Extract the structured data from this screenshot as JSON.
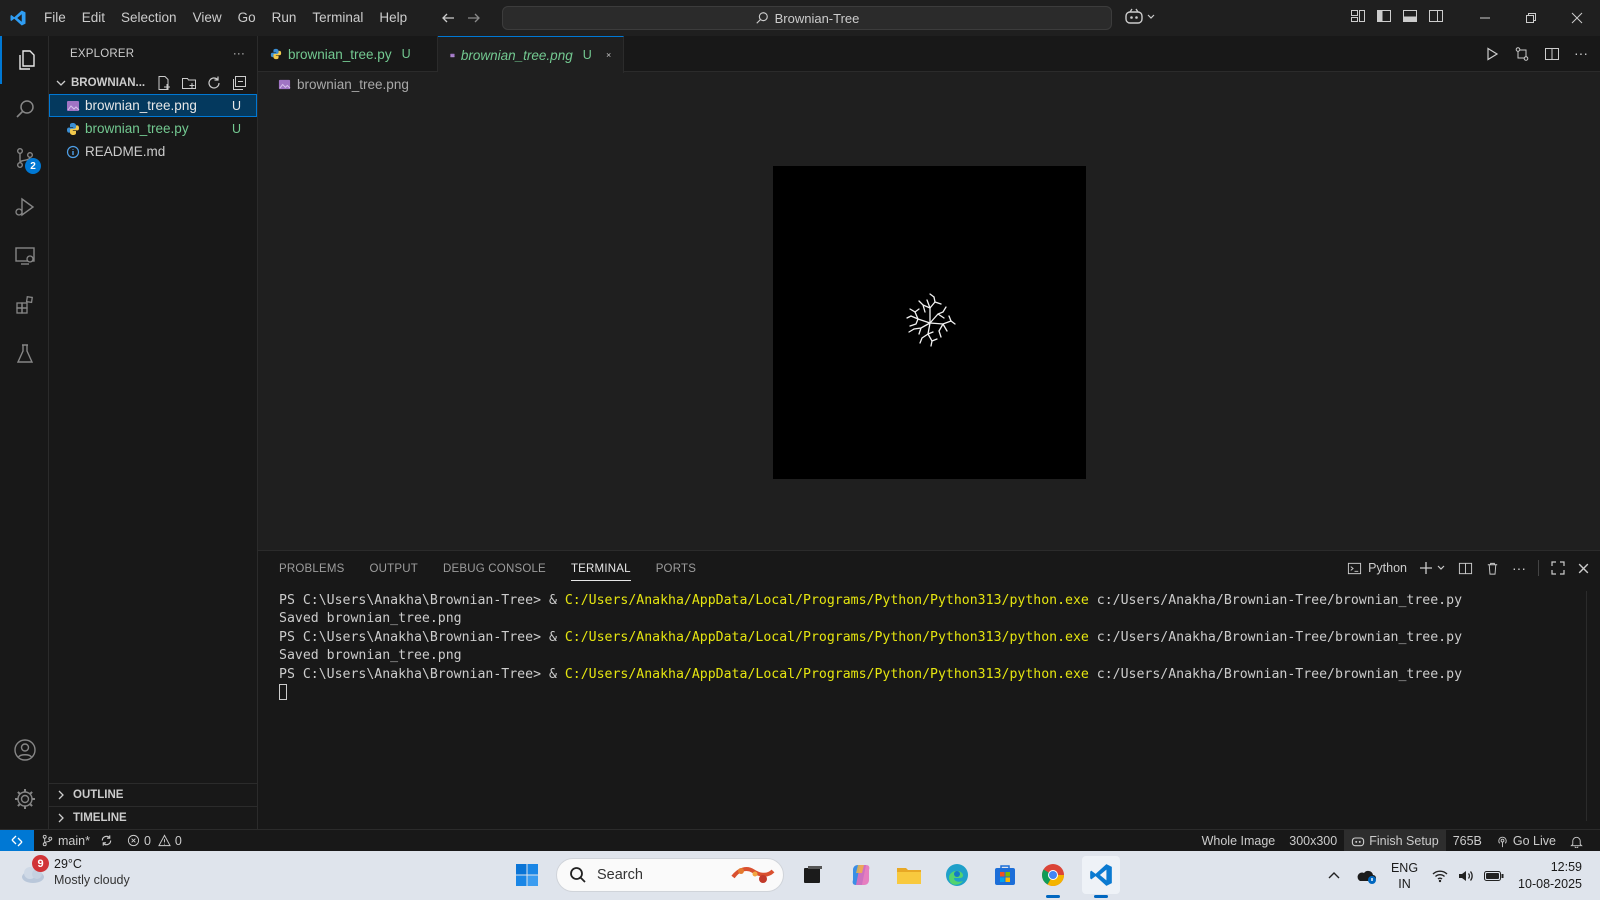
{
  "titlebar": {
    "menu": [
      "File",
      "Edit",
      "Selection",
      "View",
      "Go",
      "Run",
      "Terminal",
      "Help"
    ],
    "command_center": "Brownian-Tree"
  },
  "activitybar": {
    "items": [
      "explorer",
      "search",
      "source-control",
      "run-and-debug",
      "remote-explorer",
      "extensions",
      "testing"
    ],
    "source_control_badge": "2"
  },
  "sidebar": {
    "title": "EXPLORER",
    "folder": "BROWNIAN...",
    "files": [
      {
        "name": "brownian_tree.png",
        "status": "U",
        "icon": "image-icon"
      },
      {
        "name": "brownian_tree.py",
        "status": "U",
        "icon": "python-icon"
      },
      {
        "name": "README.md",
        "status": "",
        "icon": "info-icon"
      }
    ],
    "outline": "OUTLINE",
    "timeline": "TIMELINE"
  },
  "editor": {
    "tabs": [
      {
        "label": "brownian_tree.py",
        "status": "U"
      },
      {
        "label": "brownian_tree.png",
        "status": "U"
      }
    ],
    "breadcrumb": "brownian_tree.png"
  },
  "panel": {
    "tabs": [
      "PROBLEMS",
      "OUTPUT",
      "DEBUG CONSOLE",
      "TERMINAL",
      "PORTS"
    ],
    "active_tab": "TERMINAL",
    "shell": "Python",
    "terminal_lines": [
      {
        "prompt": "PS C:\\Users\\Anakha\\Brownian-Tree> & ",
        "exe": "C:/Users/Anakha/AppData/Local/Programs/Python/Python313/python.exe",
        "arg": " c:/Users/Anakha/Brownian-Tree/brownian_tree.py"
      },
      {
        "output": "Saved brownian_tree.png"
      },
      {
        "prompt": "PS C:\\Users\\Anakha\\Brownian-Tree> & ",
        "exe": "C:/Users/Anakha/AppData/Local/Programs/Python/Python313/python.exe",
        "arg": " c:/Users/Anakha/Brownian-Tree/brownian_tree.py"
      },
      {
        "output": "Saved brownian_tree.png"
      },
      {
        "prompt": "PS C:\\Users\\Anakha\\Brownian-Tree> & ",
        "exe": "C:/Users/Anakha/AppData/Local/Programs/Python/Python313/python.exe",
        "arg": " c:/Users/Anakha/Brownian-Tree/brownian_tree.py"
      }
    ]
  },
  "statusbar": {
    "branch": "main*",
    "errors": "0",
    "warnings": "0",
    "image_mode": "Whole Image",
    "dimensions": "300x300",
    "finish_setup": "Finish Setup",
    "size": "765B",
    "go_live": "Go Live"
  },
  "taskbar": {
    "weather_badge": "9",
    "temperature": "29°C",
    "condition": "Mostly cloudy",
    "search": "Search",
    "lang_line1": "ENG",
    "lang_line2": "IN",
    "time": "12:59",
    "date": "10-08-2025"
  },
  "colors": {
    "accent": "#0078d4",
    "untracked": "#73c991",
    "terminal_exe": "#e5e510",
    "editor_bg": "#1f1f1f",
    "sidebar_bg": "#181818"
  }
}
